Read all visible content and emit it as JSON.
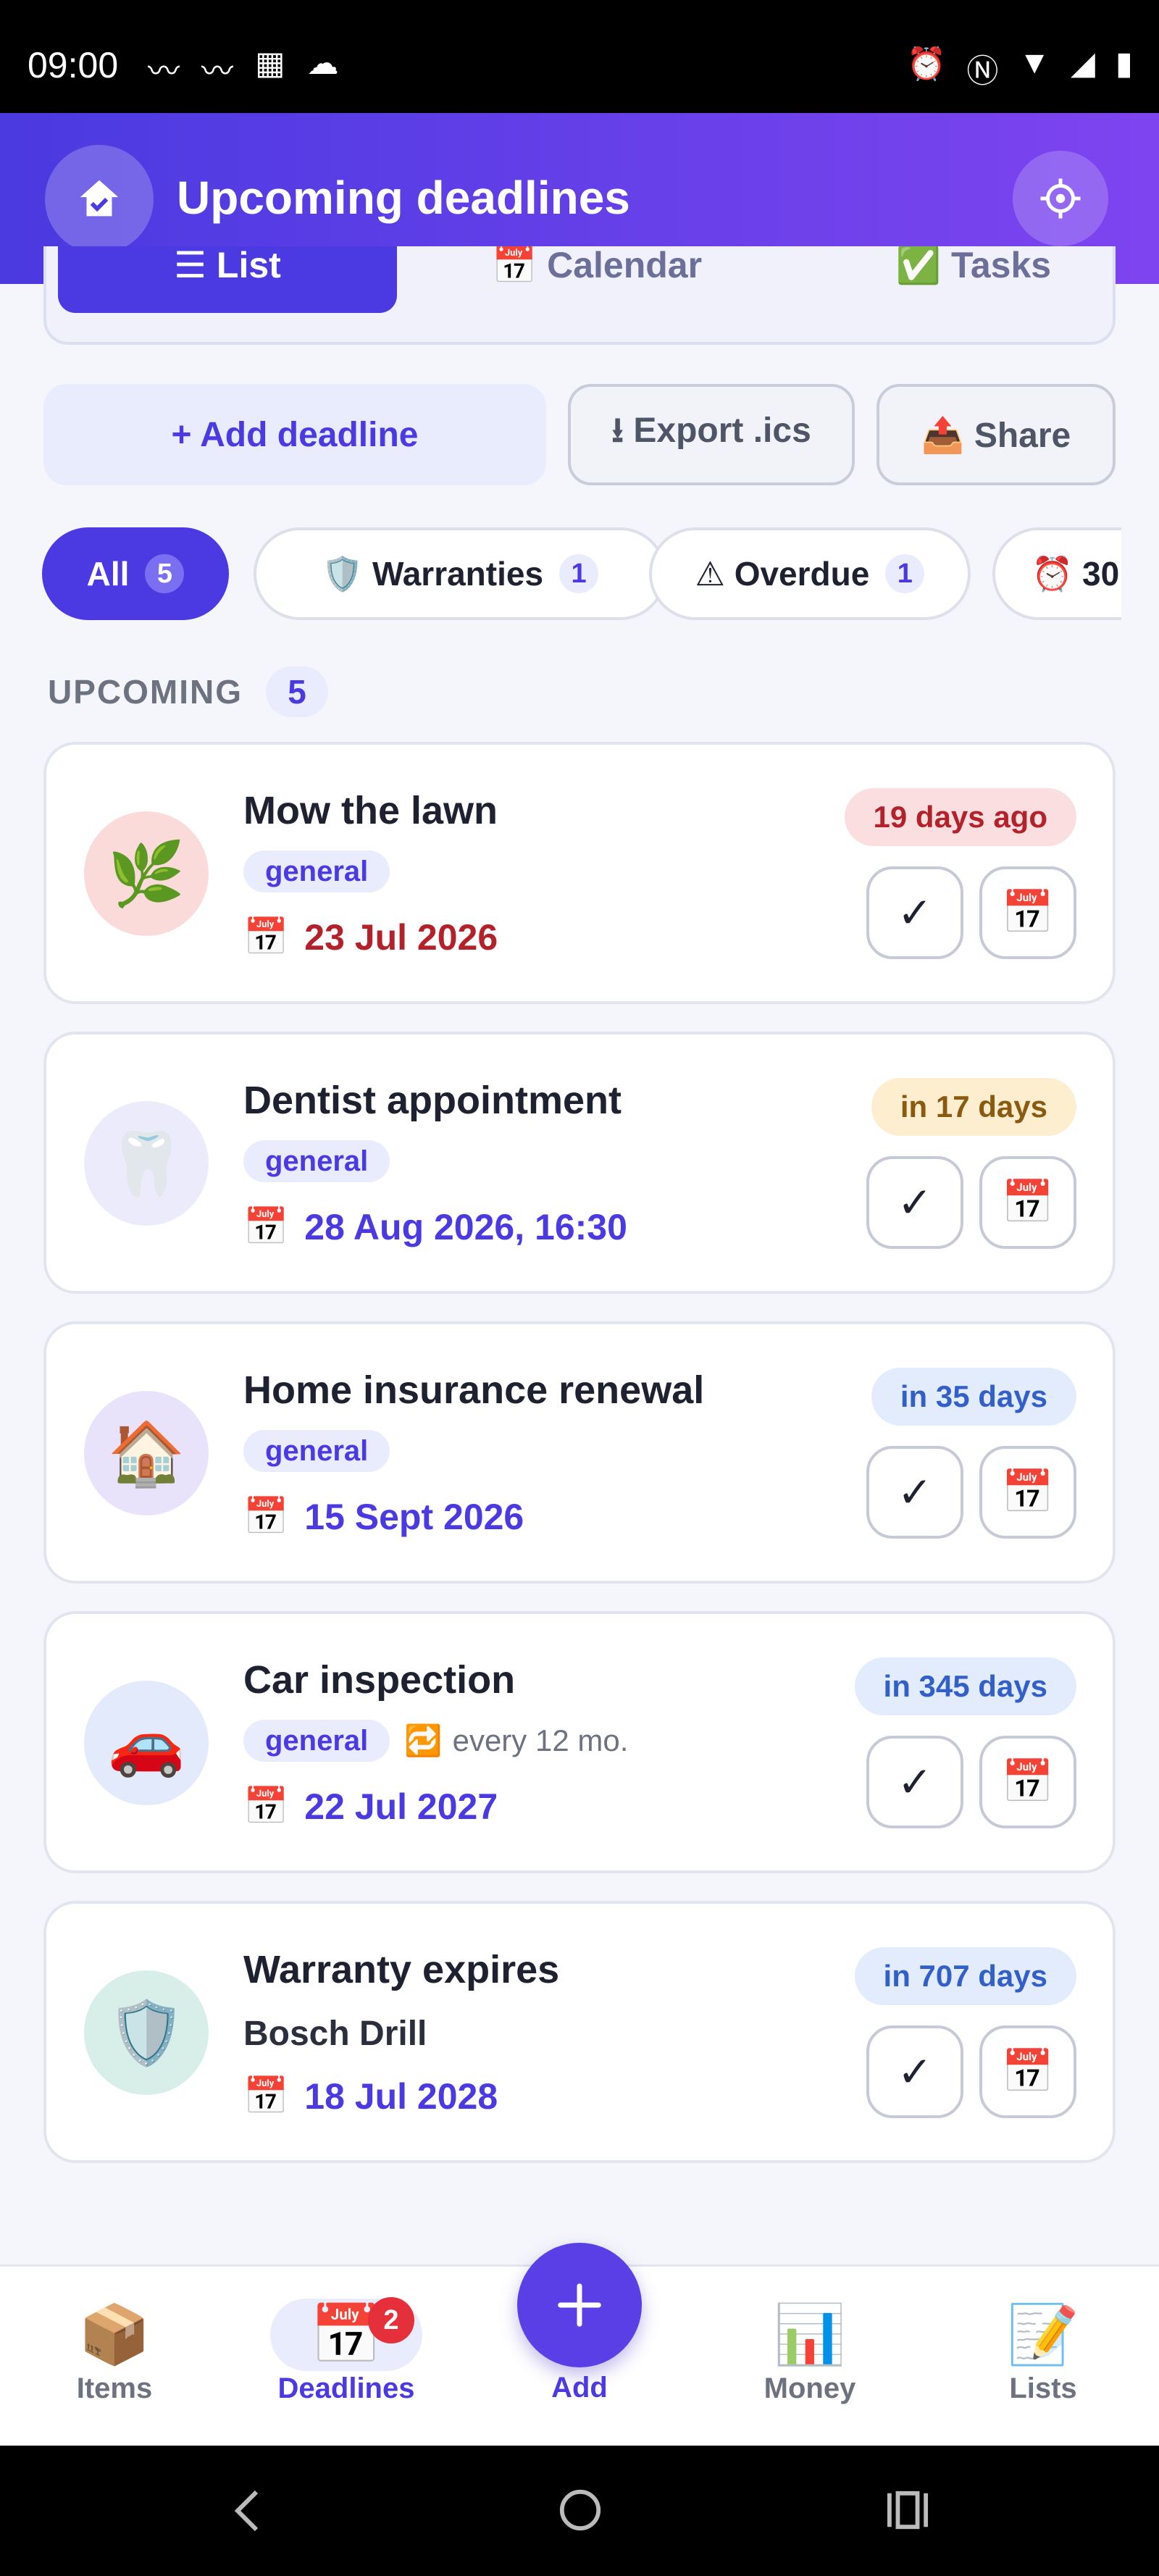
{
  "status_bar": {
    "time": "09:00"
  },
  "header": {
    "title": "Upcoming deadlines"
  },
  "view_tabs": [
    {
      "label": "☰ List"
    },
    {
      "label": "📅 Calendar"
    },
    {
      "label": "✅ Tasks"
    }
  ],
  "actions": {
    "add": "+ Add deadline",
    "export": "⭳ Export .ics",
    "share": "📤 Share"
  },
  "filters": [
    {
      "label": "All",
      "count": "5"
    },
    {
      "label": "🛡️ Warranties",
      "count": "1"
    },
    {
      "label": "⚠ Overdue",
      "count": "1"
    },
    {
      "label": "⏰ 30"
    }
  ],
  "section": {
    "label": "UPCOMING",
    "count": "5"
  },
  "deadlines": [
    {
      "icon": "🌿",
      "title": "Mow the lawn",
      "tag": "general",
      "date": "23 Jul 2026",
      "badge": "19 days ago",
      "date_color": "#b3222a",
      "badge_bg": "#fbdfe0",
      "badge_fg": "#b3222a",
      "icon_bg": "#fadbd9"
    },
    {
      "icon": "🦷",
      "title": "Dentist appointment",
      "tag": "general",
      "date": "28 Aug 2026, 16:30",
      "badge": "in 17 days",
      "date_color": "#4b3ae2",
      "badge_bg": "#fdeed0",
      "badge_fg": "#8a5a10",
      "icon_bg": "#ecebfb"
    },
    {
      "icon": "🏠",
      "title": "Home insurance renewal",
      "tag": "general",
      "date": "15 Sept 2026",
      "badge": "in 35 days",
      "date_color": "#4b3ae2",
      "badge_bg": "#e2ecfd",
      "badge_fg": "#3360c8",
      "icon_bg": "#e8e2fb"
    },
    {
      "icon": "🚗",
      "title": "Car inspection",
      "tag": "general",
      "repeat": "every 12 mo.",
      "date": "22 Jul 2027",
      "badge": "in 345 days",
      "date_color": "#4b3ae2",
      "badge_bg": "#e2ecfd",
      "badge_fg": "#3360c8",
      "icon_bg": "#e2eafb"
    },
    {
      "icon": "🛡️",
      "title": "Warranty expires",
      "subtitle": "Bosch Drill",
      "date": "18 Jul 2028",
      "badge": "in 707 days",
      "date_color": "#4b3ae2",
      "badge_bg": "#e2ecfd",
      "badge_fg": "#3360c8",
      "icon_bg": "#d8efe9"
    }
  ],
  "card_buttons": {
    "done": "✓",
    "calendar": "📅"
  },
  "bottom_nav": [
    {
      "icon": "📦",
      "label": "Items"
    },
    {
      "icon": "📅",
      "label": "Deadlines",
      "badge": "2"
    },
    {
      "icon": "＋",
      "label": "Add"
    },
    {
      "icon": "📊",
      "label": "Money"
    },
    {
      "icon": "📝",
      "label": "Lists"
    }
  ]
}
